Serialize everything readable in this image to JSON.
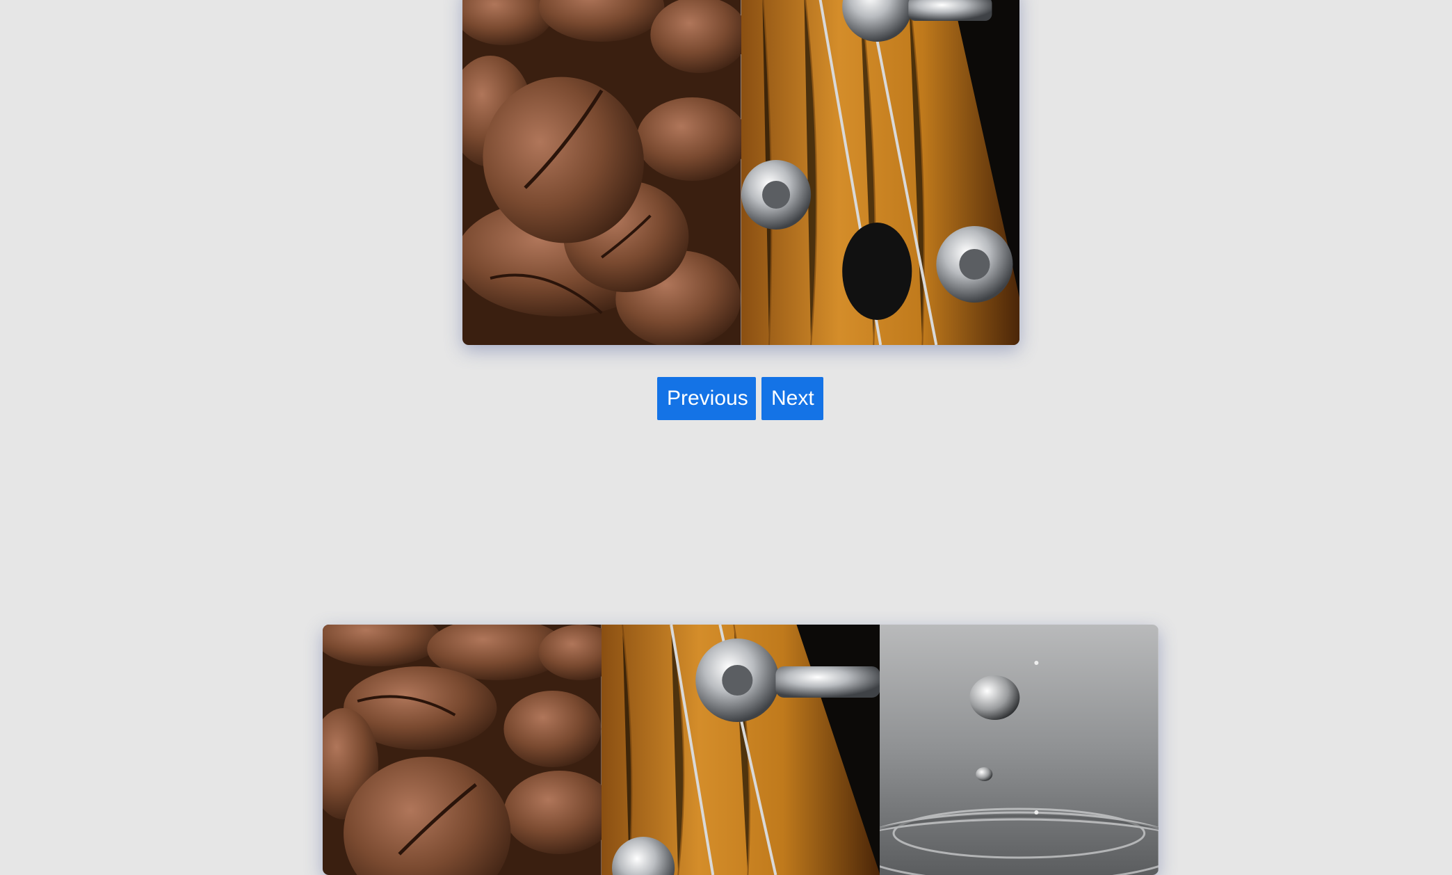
{
  "carousel_top": {
    "slides": [
      {
        "icon": "coffee-beans-image"
      },
      {
        "icon": "guitar-headstock-image"
      }
    ]
  },
  "controls": {
    "previous_label": "Previous",
    "next_label": "Next",
    "accent": "#1473e6"
  },
  "carousel_bottom": {
    "slides": [
      {
        "icon": "coffee-beans-image"
      },
      {
        "icon": "guitar-headstock-image"
      },
      {
        "icon": "water-droplet-image"
      }
    ]
  },
  "colors": {
    "background": "#e6e6e6",
    "coffee": "#6b4028",
    "wood": "#b8741e",
    "chrome": "#c9ccd0",
    "water": "#8a8d8f"
  }
}
